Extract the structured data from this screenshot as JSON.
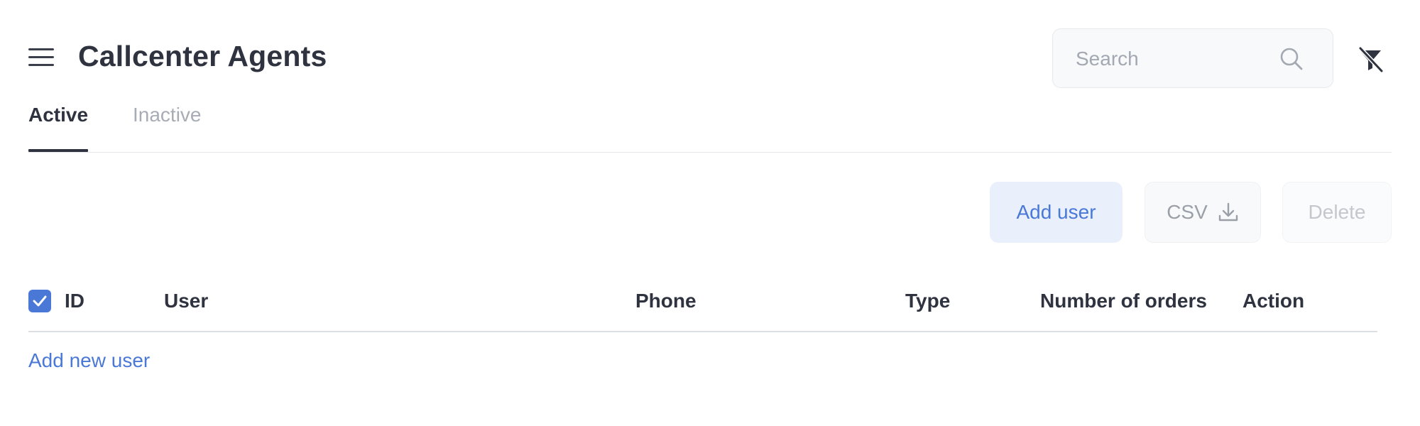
{
  "header": {
    "title": "Callcenter Agents",
    "menu_icon": "hamburger-menu-icon",
    "search": {
      "placeholder": "Search",
      "value": "",
      "icon": "search-icon"
    },
    "filter_icon": "filter-clear-icon"
  },
  "tabs": [
    {
      "label": "Active",
      "selected": true
    },
    {
      "label": "Inactive",
      "selected": false
    }
  ],
  "toolbar": {
    "add_user_label": "Add user",
    "csv_label": "CSV",
    "csv_icon": "download-icon",
    "delete_label": "Delete"
  },
  "table": {
    "select_all_checked": true,
    "columns": [
      "ID",
      "User",
      "Phone",
      "Type",
      "Number of orders",
      "Action"
    ],
    "rows": []
  },
  "add_new_user_label": "Add new user",
  "colors": {
    "accent": "#4a78d6",
    "accent_light_bg": "#e9f0fc",
    "text_primary": "#2f3340",
    "text_muted": "#a7acb5"
  }
}
